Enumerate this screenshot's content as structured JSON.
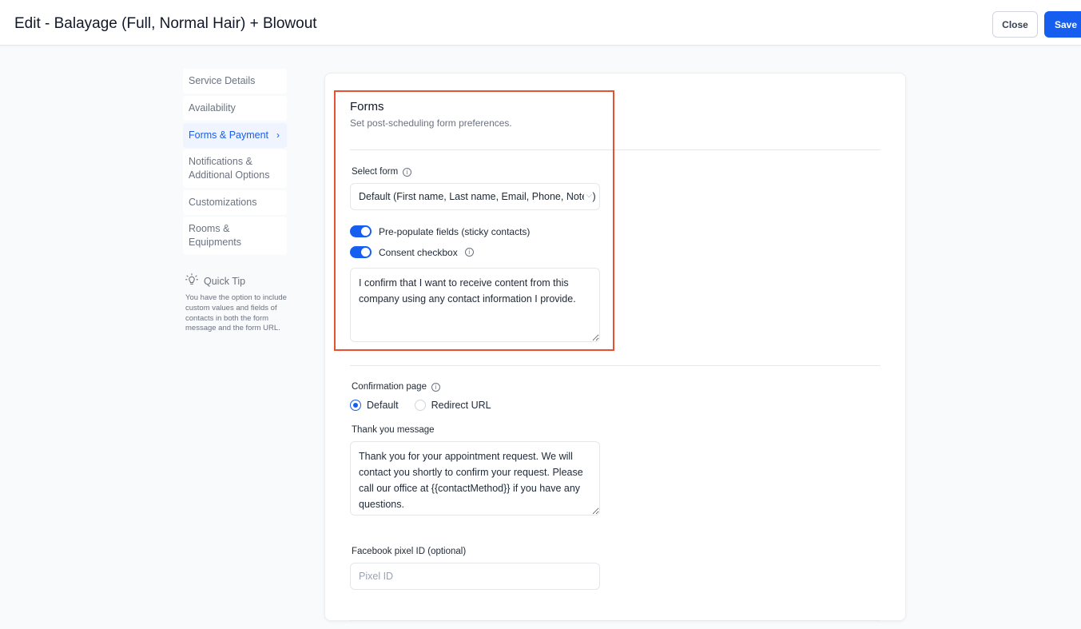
{
  "header": {
    "title": "Edit - Balayage (Full, Normal Hair) + Blowout",
    "close_label": "Close",
    "save_label": "Save"
  },
  "sidebar": {
    "items": [
      {
        "label": "Service Details"
      },
      {
        "label": "Availability"
      },
      {
        "label": "Forms & Payment",
        "active": true
      },
      {
        "label": "Notifications & Additional Options"
      },
      {
        "label": "Customizations"
      },
      {
        "label": "Rooms & Equipments"
      }
    ],
    "tip_title": "Quick Tip",
    "tip_text": "You have the option to include custom values and fields of contacts in both the form message and the form URL."
  },
  "forms": {
    "title": "Forms",
    "subtitle": "Set post-scheduling form preferences.",
    "select_form_label": "Select form",
    "select_form_value": "Default (First name, Last name, Email, Phone, Notes)",
    "prepopulate_label": "Pre-populate fields (sticky contacts)",
    "prepopulate_on": true,
    "consent_label": "Consent checkbox",
    "consent_on": true,
    "consent_text": "I confirm that I want to receive content from this company using any contact information I provide."
  },
  "confirmation": {
    "label": "Confirmation page",
    "options": [
      "Default",
      "Redirect URL"
    ],
    "selected": "Default",
    "thankyou_label": "Thank you message",
    "thankyou_text": "Thank you for your appointment request. We will contact you shortly to confirm your request. Please call our office at {{contactMethod}} if you have any questions."
  },
  "pixel": {
    "label": "Facebook pixel ID (optional)",
    "placeholder": "Pixel ID"
  },
  "colors": {
    "accent": "#155eef",
    "highlight": "#e8512f"
  }
}
